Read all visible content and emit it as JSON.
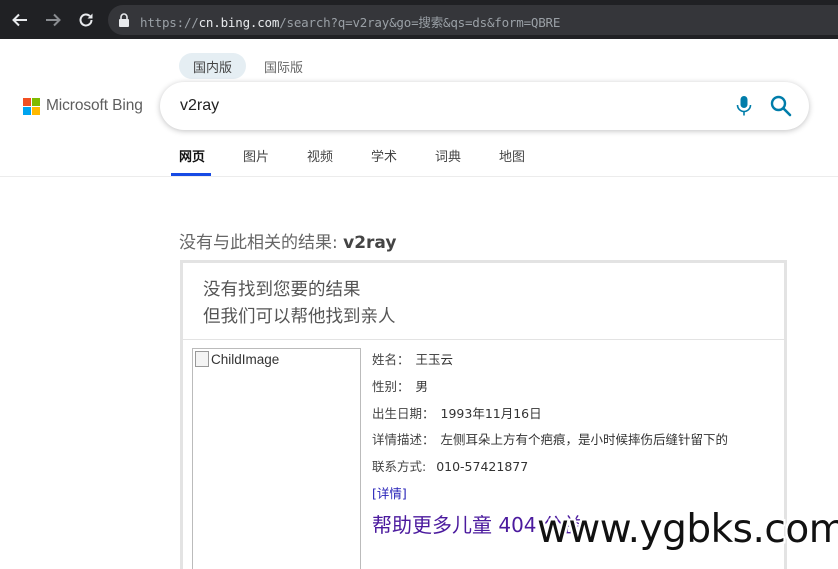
{
  "browser": {
    "url_scheme": "https://",
    "url_host": "cn.bing.com",
    "url_path": "/search?q=v2ray&go=搜索&qs=ds&form=QBRE",
    "icons": [
      "back-arrow-icon",
      "forward-arrow-icon",
      "reload-icon",
      "lock-icon"
    ]
  },
  "header": {
    "scope_domestic": "国内版",
    "scope_international": "国际版",
    "logo_text": "Microsoft Bing",
    "logo_colors": [
      "#f25022",
      "#7fba00",
      "#00a4ef",
      "#ffb900"
    ],
    "search_query": "v2ray",
    "accent_color": "#174ae4"
  },
  "tabs": [
    {
      "label": "网页",
      "active": true
    },
    {
      "label": "图片",
      "active": false
    },
    {
      "label": "视频",
      "active": false
    },
    {
      "label": "学术",
      "active": false
    },
    {
      "label": "词典",
      "active": false
    },
    {
      "label": "地图",
      "active": false
    }
  ],
  "result": {
    "no_result_prefix": "没有与此相关的结果: ",
    "no_result_query": "v2ray",
    "card_line1": "没有找到您要的结果",
    "card_line2": "但我们可以帮他找到亲人",
    "image_alt": "ChildImage",
    "fields": [
      {
        "label": "姓名：",
        "value": "王玉云"
      },
      {
        "label": "性别：",
        "value": "男"
      },
      {
        "label": "出生日期：",
        "value": "1993年11月16日"
      },
      {
        "label": "详情描述：",
        "value": "左侧耳朵上方有个疤痕，是小时候摔伤后缝针留下的"
      },
      {
        "label": "联系方式: ",
        "value": "010-57421877"
      }
    ],
    "detail_link": "[详情]",
    "help_link": "帮助更多儿童 404 公益"
  },
  "watermark": "www.ygbks.com"
}
